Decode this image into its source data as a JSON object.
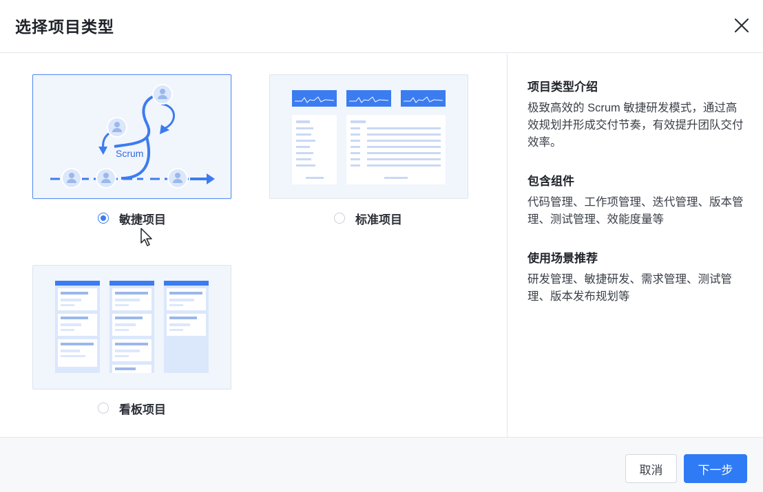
{
  "dialog": {
    "title": "选择项目类型",
    "close_icon": "close-icon"
  },
  "project_types": [
    {
      "label": "敏捷项目",
      "selected": true,
      "illustration_text": "Scrum",
      "illustration": "scrum-cycle-illustration"
    },
    {
      "label": "标准项目",
      "selected": false,
      "illustration": "standard-dashboard-illustration"
    },
    {
      "label": "看板项目",
      "selected": false,
      "illustration": "kanban-board-illustration"
    }
  ],
  "info": {
    "intro_title": "项目类型介绍",
    "intro_text": "极致高效的 Scrum 敏捷研发模式，通过高效规划并形成交付节奏，有效提升团队交付效率。",
    "components_title": "包含组件",
    "components_text": "代码管理、工作项管理、迭代管理、版本管理、测试管理、效能度量等",
    "scenario_title": "使用场景推荐",
    "scenario_text": "研发管理、敏捷研发、需求管理、测试管理、版本发布规划等"
  },
  "footer": {
    "cancel_label": "取消",
    "next_label": "下一步"
  },
  "colors": {
    "accent": "#2f7bf5",
    "card_bg": "#f1f5fc"
  }
}
